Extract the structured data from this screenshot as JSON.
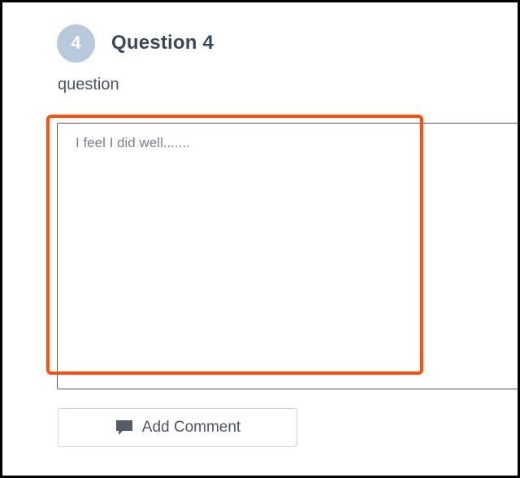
{
  "question": {
    "number": "4",
    "title": "Question 4",
    "text": "question"
  },
  "answer": {
    "placeholder": "I feel I did well.......",
    "value": ""
  },
  "comment_button": {
    "label": "Add Comment",
    "icon": "comment-icon"
  },
  "colors": {
    "badge": "#b7c9da",
    "highlight": "#ff4f0a",
    "title": "#3d4757"
  }
}
